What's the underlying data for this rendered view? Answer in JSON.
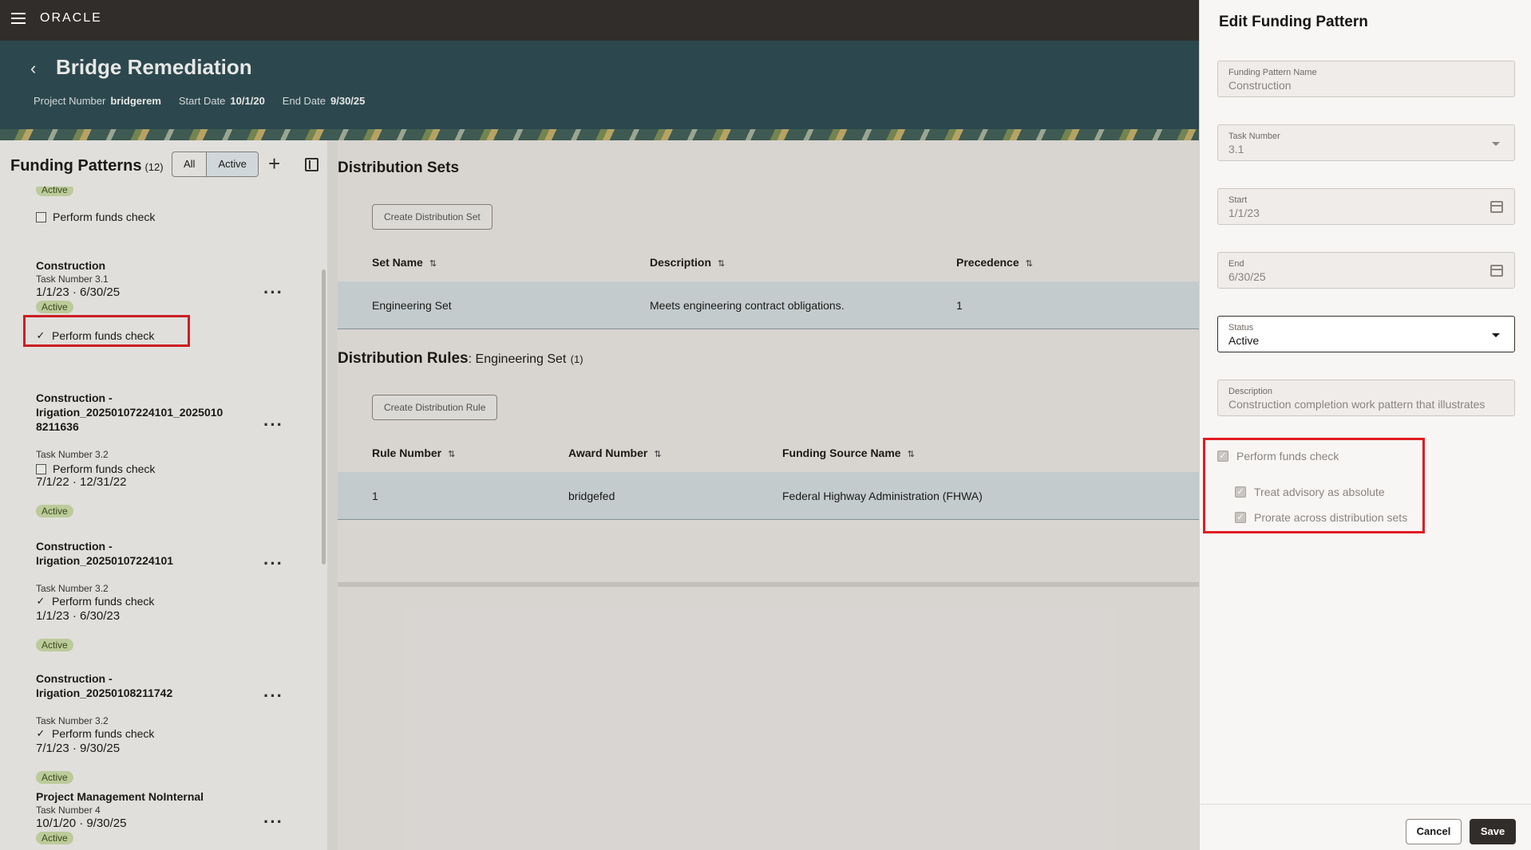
{
  "app": {
    "logo": "ORACLE"
  },
  "project": {
    "title": "Bridge Remediation",
    "number_label": "Project Number",
    "number": "bridgerem",
    "start_label": "Start Date",
    "start": "10/1/20",
    "end_label": "End Date",
    "end": "9/30/25"
  },
  "funding_patterns": {
    "title": "Funding Patterns",
    "count": "(12)",
    "filter_all": "All",
    "filter_active": "Active",
    "top_partial": {
      "status": "Active",
      "check_label": "Perform funds check"
    },
    "items": [
      {
        "name": "Construction",
        "task": "Task Number 3.1",
        "dates": "1/1/23 · 6/30/25",
        "status": "Active",
        "check_label": "Perform funds check",
        "checked": true
      },
      {
        "name": "Construction -\nIrigation_20250107224101_2025010\n8211636",
        "task": "Task Number 3.2",
        "dates": "7/1/22 · 12/31/22",
        "status": "Active",
        "check_label": "Perform funds check",
        "checked": false
      },
      {
        "name": "Construction -\nIrigation_20250107224101",
        "task": "Task Number 3.2",
        "dates": "1/1/23 · 6/30/23",
        "status": "Active",
        "check_label": "Perform funds check",
        "checked": true
      },
      {
        "name": "Construction -\nIrigation_20250108211742",
        "task": "Task Number 3.2",
        "dates": "7/1/23 · 9/30/25",
        "status": "Active",
        "check_label": "Perform funds check",
        "checked": true
      },
      {
        "name": "Project Management NoInternal",
        "task": "Task Number 4",
        "dates": "10/1/20 · 9/30/25",
        "status": "Active"
      }
    ]
  },
  "distribution_sets": {
    "title": "Distribution Sets",
    "create_label": "Create Distribution Set",
    "columns": [
      "Set Name",
      "Description",
      "Precedence"
    ],
    "rows": [
      [
        "Engineering Set",
        "Meets engineering contract obligations.",
        "1"
      ]
    ]
  },
  "distribution_rules": {
    "title": "Distribution Rules",
    "subtitle": ": Engineering Set",
    "count": "(1)",
    "create_label": "Create Distribution Rule",
    "columns": [
      "Rule Number",
      "Award Number",
      "Funding Source Name"
    ],
    "rows": [
      [
        "1",
        "bridgefed",
        "Federal Highway Administration (FHWA)"
      ]
    ]
  },
  "drawer": {
    "title": "Edit Funding Pattern",
    "fields": {
      "name": {
        "label": "Funding Pattern Name",
        "value": "Construction"
      },
      "task": {
        "label": "Task Number",
        "value": "3.1"
      },
      "start": {
        "label": "Start",
        "value": "1/1/23"
      },
      "end": {
        "label": "End",
        "value": "6/30/25"
      },
      "status": {
        "label": "Status",
        "value": "Active"
      },
      "description": {
        "label": "Description",
        "value": "Construction completion work pattern that illustrates"
      }
    },
    "checks": {
      "funds": "Perform funds check",
      "advisory": "Treat advisory as absolute",
      "prorate": "Prorate across distribution sets"
    },
    "cancel": "Cancel",
    "save": "Save"
  },
  "colors": {
    "topbar": "#312d2a",
    "hero": "#2b4a52",
    "highlight": "#e11b22",
    "badge": "#cfe0a9",
    "selected_row": "#d7e0e3"
  }
}
